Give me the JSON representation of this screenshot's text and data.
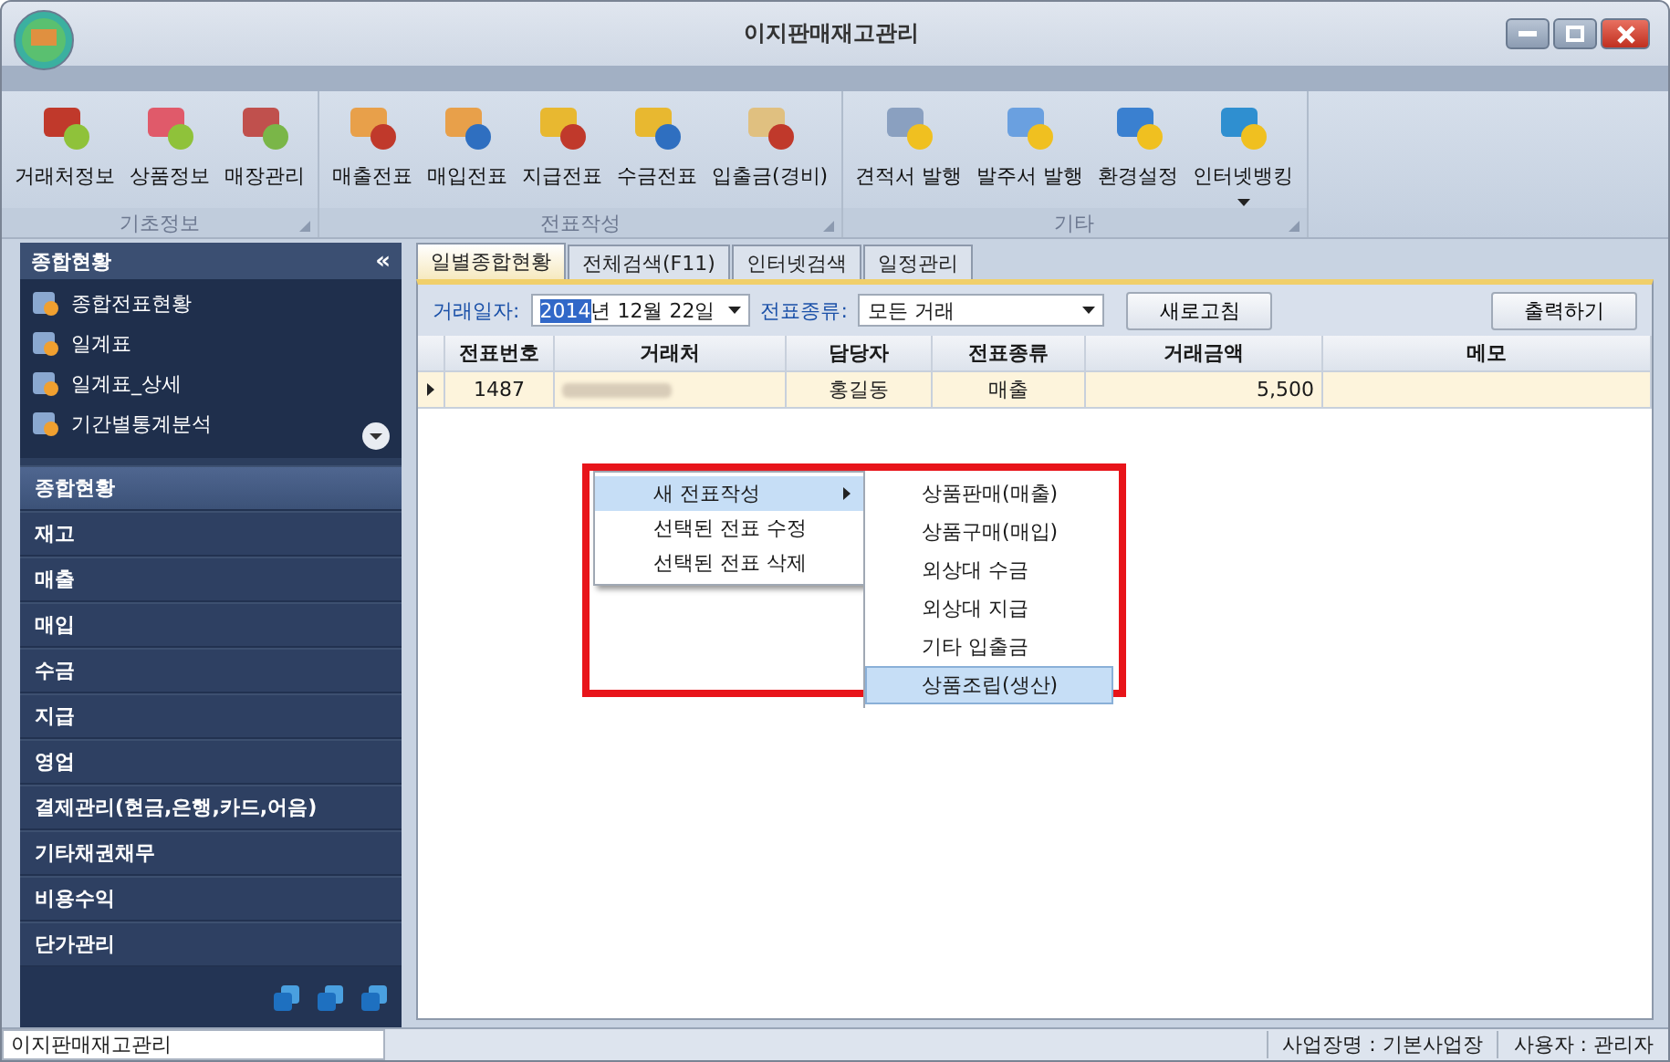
{
  "window": {
    "title": "이지판매재고관리"
  },
  "ribbon": {
    "groups": [
      {
        "label": "기초정보",
        "buttons": [
          {
            "label": "거래처정보",
            "dropdown": false
          },
          {
            "label": "상품정보",
            "dropdown": false
          },
          {
            "label": "매장관리",
            "dropdown": false
          }
        ]
      },
      {
        "label": "전표작성",
        "buttons": [
          {
            "label": "매출전표",
            "dropdown": false
          },
          {
            "label": "매입전표",
            "dropdown": false
          },
          {
            "label": "지급전표",
            "dropdown": false
          },
          {
            "label": "수금전표",
            "dropdown": false
          },
          {
            "label": "입출금(경비)",
            "dropdown": false
          }
        ]
      },
      {
        "label": "기타",
        "buttons": [
          {
            "label": "견적서 발행",
            "dropdown": false
          },
          {
            "label": "발주서 발행",
            "dropdown": false
          },
          {
            "label": "환경설정",
            "dropdown": false
          },
          {
            "label": "인터넷뱅킹",
            "dropdown": true
          }
        ]
      }
    ]
  },
  "sidebar": {
    "header": "종합현황",
    "collapse": "«",
    "items": [
      {
        "label": "종합전표현황"
      },
      {
        "label": "일계표"
      },
      {
        "label": "일계표_상세"
      },
      {
        "label": "기간별통계분석"
      }
    ],
    "nav": [
      {
        "label": "종합현황",
        "selected": true
      },
      {
        "label": "재고",
        "selected": false
      },
      {
        "label": "매출",
        "selected": false
      },
      {
        "label": "매입",
        "selected": false
      },
      {
        "label": "수금",
        "selected": false
      },
      {
        "label": "지급",
        "selected": false
      },
      {
        "label": "영업",
        "selected": false
      },
      {
        "label": "결제관리(현금,은행,카드,어음)",
        "selected": false
      },
      {
        "label": "기타채권채무",
        "selected": false
      },
      {
        "label": "비용수익",
        "selected": false
      },
      {
        "label": "단가관리",
        "selected": false
      }
    ]
  },
  "tabs": [
    {
      "label": "일별종합현황",
      "selected": true
    },
    {
      "label": "전체검색(F11)",
      "selected": false
    },
    {
      "label": "인터넷검색",
      "selected": false
    },
    {
      "label": "일정관리",
      "selected": false
    }
  ],
  "filter": {
    "date_label": "거래일자:",
    "date_selected": "2014",
    "date_rest": "년 12월 22일",
    "type_label": "전표종류:",
    "type_value": "모든 거래",
    "refresh": "새로고침",
    "print": "출력하기"
  },
  "table": {
    "columns": [
      "전표번호",
      "거래처",
      "담당자",
      "전표종류",
      "거래금액",
      "메모"
    ],
    "rows": [
      {
        "number": "1487",
        "manager": "홍길동",
        "type": "매출",
        "amount": "5,500",
        "memo": "",
        "selected": true
      }
    ]
  },
  "context_menu": {
    "items": [
      {
        "label": "새 전표작성",
        "submenu": true,
        "selected": true
      },
      {
        "label": "선택된 전표 수정",
        "submenu": false,
        "selected": false
      },
      {
        "label": "선택된 전표 삭제",
        "submenu": false,
        "selected": false
      }
    ],
    "submenu": [
      {
        "label": "상품판매(매출)",
        "selected": false
      },
      {
        "label": "상품구매(매입)",
        "selected": false
      },
      {
        "label": "외상대 수금",
        "selected": false
      },
      {
        "label": "외상대 지급",
        "selected": false
      },
      {
        "label": "기타 입출금",
        "selected": false
      },
      {
        "label": "상품조립(생산)",
        "selected": true
      }
    ]
  },
  "status_bar": {
    "left": "이지판매재고관리",
    "business": "사업장명 : 기본사업장",
    "user": "사용자 : 관리자"
  }
}
